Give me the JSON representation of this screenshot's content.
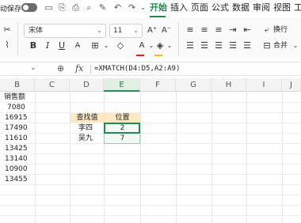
{
  "toolbar": {
    "autosave_label": "动保存",
    "tabs": [
      "开始",
      "插入",
      "页面",
      "公式",
      "数据",
      "审阅",
      "视图",
      "工"
    ],
    "active_tab": "开始"
  },
  "ribbon": {
    "font_name": "宋体",
    "font_size": "11",
    "wrap_label": "换行",
    "merge_label": "合并",
    "bold": "B",
    "italic": "I",
    "underline": "U"
  },
  "formula_bar": {
    "fx": "fx",
    "formula": "=XMATCH(D4:D5,A2:A9)"
  },
  "columns": [
    "B",
    "C",
    "D",
    "E",
    "F",
    "G",
    "H",
    "I",
    "J"
  ],
  "sheet": {
    "sales_header": "销售额",
    "sales": [
      "7080",
      "16915",
      "17490",
      "11610",
      "13425",
      "13140",
      "10900",
      "13455"
    ],
    "lookup_header": "查找值",
    "position_header": "位置",
    "lookups": [
      {
        "name": "李四",
        "position": "2"
      },
      {
        "name": "吴九",
        "position": "7"
      }
    ]
  },
  "colors": {
    "accent": "#1e8a4c",
    "header_fill": "#fde9c4",
    "selection_border": "#1f8a4f"
  }
}
